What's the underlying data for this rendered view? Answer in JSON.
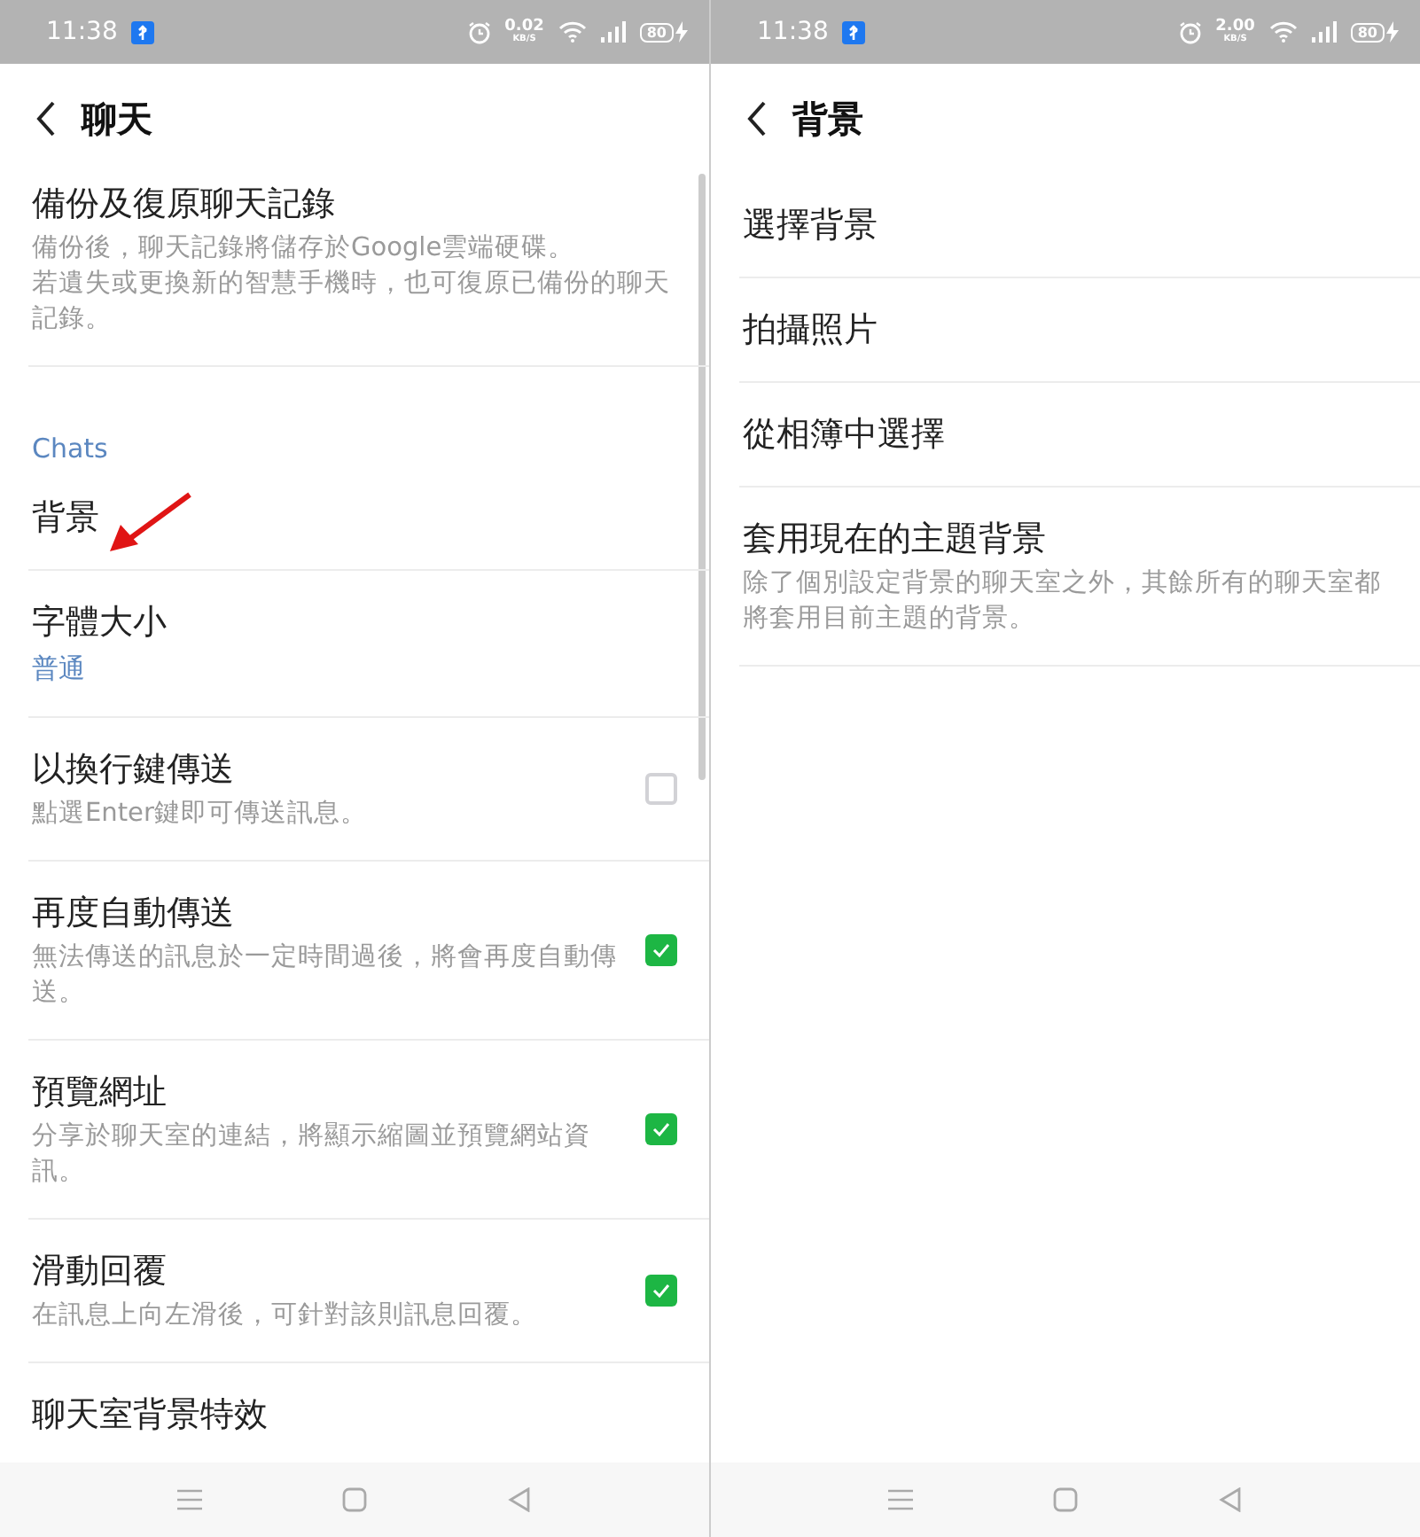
{
  "screens": [
    {
      "status_bar": {
        "time": "11:38",
        "speed": "0.02",
        "speed_unit": "KB/S",
        "battery": "80"
      },
      "header": {
        "title": "聊天"
      },
      "scrollbar": true,
      "items": [
        {
          "kind": "setting",
          "title": "備份及復原聊天記錄",
          "description": [
            "備份後，聊天記錄將儲存於Google雲端硬碟。",
            "若遺失或更換新的智慧手機時，也可復原已備份的聊天記錄。"
          ]
        },
        {
          "kind": "section",
          "title": "Chats"
        },
        {
          "kind": "setting",
          "title": "背景",
          "arrow": true
        },
        {
          "kind": "setting",
          "title": "字體大小",
          "value": "普通"
        },
        {
          "kind": "checkbox",
          "title": "以換行鍵傳送",
          "description": "點選Enter鍵即可傳送訊息。",
          "checked": false
        },
        {
          "kind": "checkbox",
          "title": "再度自動傳送",
          "description": "無法傳送的訊息於一定時間過後，將會再度自動傳送。",
          "checked": true
        },
        {
          "kind": "checkbox",
          "title": "預覽網址",
          "description": "分享於聊天室的連結，將顯示縮圖並預覽網站資訊。",
          "checked": true
        },
        {
          "kind": "checkbox",
          "title": "滑動回覆",
          "description": "在訊息上向左滑後，可針對該則訊息回覆。",
          "checked": true
        },
        {
          "kind": "setting",
          "title": "聊天室背景特效"
        }
      ]
    },
    {
      "status_bar": {
        "time": "11:38",
        "speed": "2.00",
        "speed_unit": "KB/S",
        "battery": "80"
      },
      "header": {
        "title": "背景"
      },
      "items": [
        {
          "kind": "setting",
          "title": "選擇背景"
        },
        {
          "kind": "setting",
          "title": "拍攝照片"
        },
        {
          "kind": "setting",
          "title": "從相簿中選擇"
        },
        {
          "kind": "setting",
          "title": "套用現在的主題背景",
          "description": "除了個別設定背景的聊天室之外，其餘所有的聊天室都將套用目前主題的背景。"
        }
      ]
    }
  ]
}
